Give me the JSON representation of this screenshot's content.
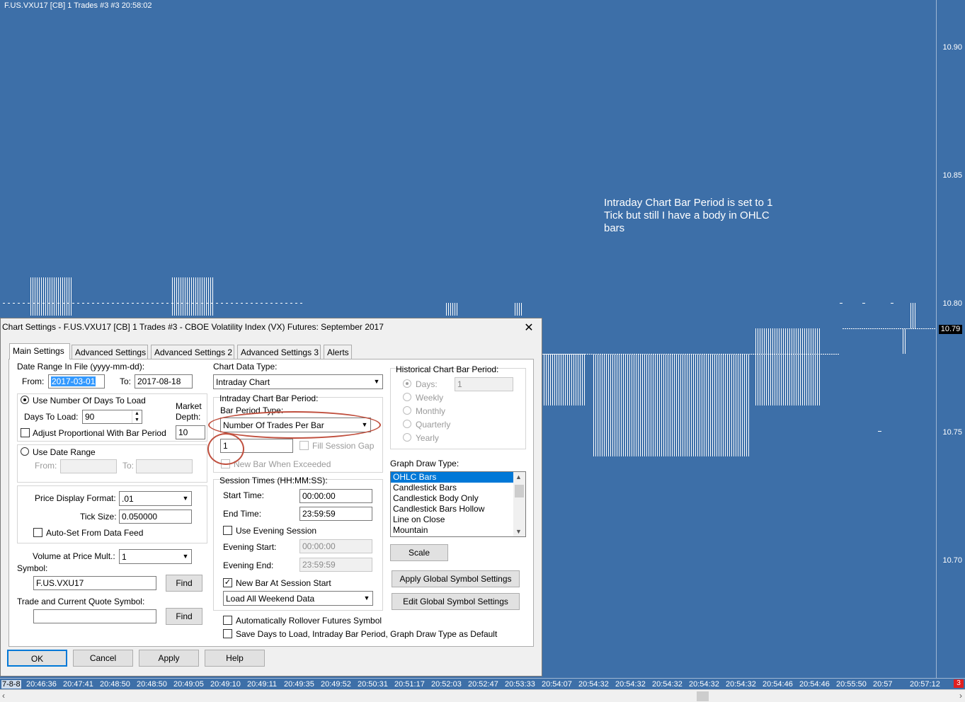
{
  "chart": {
    "title": "F.US.VXU17 [CB]  1 Trades  #3 #3 20:58:02",
    "annotation": "Intraday Chart Bar Period is set to 1 Tick but still I have a body in OHLC bars",
    "price_labels": [
      "10.90",
      "10.85",
      "10.80",
      "10.75",
      "10.70"
    ],
    "current_price": "10.79",
    "time_first": "7-8-8",
    "time_labels": [
      "20:46:36",
      "20:47:41",
      "20:48:50",
      "20:48:50",
      "20:49:05",
      "20:49:10",
      "20:49:11",
      "20:49:35",
      "20:49:52",
      "20:50:31",
      "20:51:17",
      "20:52:03",
      "20:52:47",
      "20:53:33",
      "20:54:07",
      "20:54:32",
      "20:54:32",
      "20:54:32",
      "20:54:32",
      "20:54:32",
      "20:54:46",
      "20:54:46",
      "20:55:50",
      "20:57",
      "20:57:12"
    ],
    "corner_badge": "3",
    "colors": {
      "background": "#3d6fa8",
      "bars": "#ffffff"
    }
  },
  "dialog": {
    "title": "Chart Settings - F.US.VXU17 [CB]  1 Trades  #3 - CBOE Volatility Index (VX) Futures: September 2017",
    "tabs": [
      "Main Settings",
      "Advanced Settings",
      "Advanced Settings 2",
      "Advanced Settings 3",
      "Alerts"
    ],
    "date_range_label": "Date Range In File (yyyy-mm-dd):",
    "from_label": "From:",
    "from_value": "2017-03-01",
    "to_label": "To:",
    "to_value": "2017-08-18",
    "use_days_label": "Use Number Of Days To Load",
    "days_to_load_label": "Days To Load:",
    "days_to_load_value": "90",
    "market_depth_label_1": "Market",
    "market_depth_label_2": "Depth:",
    "market_depth_value": "10",
    "adjust_label": "Adjust Proportional With Bar Period",
    "use_date_range_label": "Use Date Range",
    "dr_from_label": "From:",
    "dr_to_label": "To:",
    "price_format_label": "Price Display Format:",
    "price_format_value": ".01",
    "tick_size_label": "Tick Size:",
    "tick_size_value": "0.050000",
    "autoset_label": "Auto-Set From Data Feed",
    "volume_mult_label": "Volume at Price Mult.:",
    "volume_mult_value": "1",
    "symbol_label": "Symbol:",
    "symbol_value": "F.US.VXU17",
    "find_label": "Find",
    "trade_symbol_label": "Trade and Current Quote Symbol:",
    "trade_symbol_value": "",
    "find2_label": "Find",
    "chart_data_type_label": "Chart Data Type:",
    "chart_data_type_value": "Intraday Chart",
    "intraday_period_label": "Intraday Chart Bar Period:",
    "bar_period_type_label": "Bar Period Type:",
    "bar_period_type_value": "Number Of Trades Per Bar",
    "bar_period_value": "1",
    "fill_session_gap_label": "Fill Session Gap",
    "new_bar_exceeded_label": "New Bar When Exceeded",
    "session_times_label": "Session Times (HH:MM:SS):",
    "start_time_label": "Start Time:",
    "start_time_value": "00:00:00",
    "end_time_label": "End Time:",
    "end_time_value": "23:59:59",
    "use_evening_label": "Use Evening Session",
    "evening_start_label": "Evening Start:",
    "evening_start_value": "00:00:00",
    "evening_end_label": "Evening End:",
    "evening_end_value": "23:59:59",
    "new_bar_session_label": "New Bar At Session Start",
    "weekend_value": "Load All Weekend Data",
    "auto_rollover_label": "Automatically Rollover Futures Symbol",
    "save_default_label": "Save Days to Load, Intraday Bar Period, Graph Draw Type as Default",
    "historical_label": "Historical Chart Bar Period:",
    "hist_options": [
      "Days:",
      "Weekly",
      "Monthly",
      "Quarterly",
      "Yearly"
    ],
    "hist_days_value": "1",
    "graph_draw_type_label": "Graph Draw Type:",
    "graph_draw_types": [
      "OHLC Bars",
      "Candlestick Bars",
      "Candlestick Body Only",
      "Candlestick Bars Hollow",
      "Line on Close",
      "Mountain"
    ],
    "scale_label": "Scale",
    "apply_global_label": "Apply Global Symbol Settings",
    "edit_global_label": "Edit Global Symbol Settings",
    "ok_label": "OK",
    "cancel_label": "Cancel",
    "apply_label": "Apply",
    "help_label": "Help",
    "close_glyph": "✕"
  }
}
